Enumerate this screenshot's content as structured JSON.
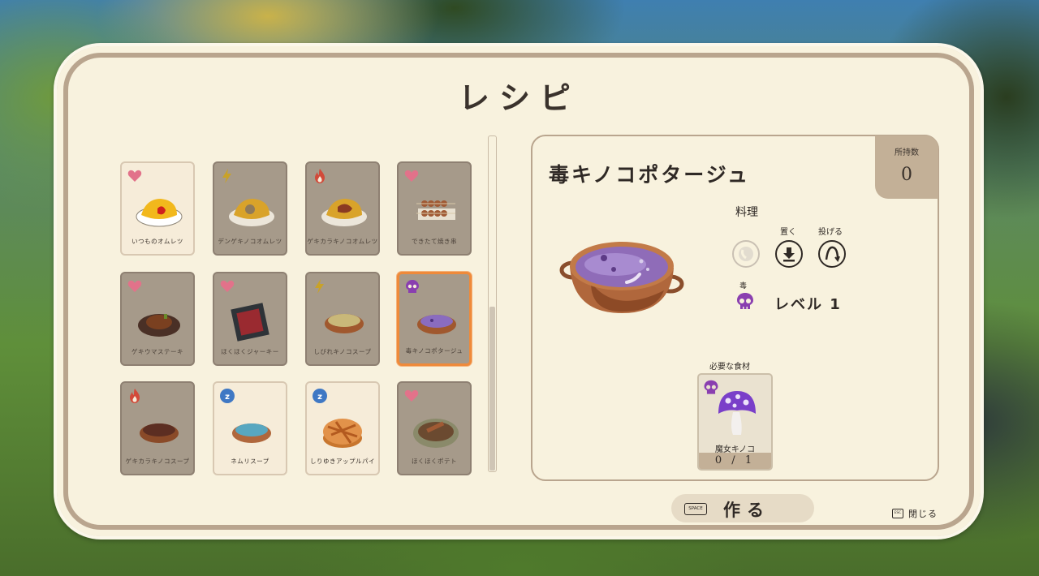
{
  "title": "レシピ",
  "recipes": [
    {
      "name": "いつものオムレツ",
      "category": "heart-icon",
      "dish": "omelet-plain",
      "state": "owned"
    },
    {
      "name": "デンゲキノコオムレツ",
      "category": "lightning-icon",
      "dish": "omelet-mushroom",
      "state": "dim"
    },
    {
      "name": "ゲキカラキノコオムレツ",
      "category": "fire-icon",
      "dish": "omelet-spicy",
      "state": "dim"
    },
    {
      "name": "できたて焼き串",
      "category": "heart-icon",
      "dish": "skewers",
      "state": "dim"
    },
    {
      "name": "ゲキウマステーキ",
      "category": "heart-icon",
      "dish": "steak",
      "state": "dim"
    },
    {
      "name": "ほくほくジャーキー",
      "category": "heart-icon",
      "dish": "jerky",
      "state": "dim"
    },
    {
      "name": "しびれキノコスープ",
      "category": "lightning-icon",
      "dish": "soup-yellow",
      "state": "dim"
    },
    {
      "name": "毒キノコポタージュ",
      "category": "skull-icon",
      "dish": "soup-purple",
      "state": "selected"
    },
    {
      "name": "ゲキカラキノコスープ",
      "category": "fire-icon",
      "dish": "soup-red",
      "state": "dim"
    },
    {
      "name": "ネムリスープ",
      "category": "sleep-icon",
      "dish": "soup-blue",
      "state": "owned"
    },
    {
      "name": "しりゆきアップルパイ",
      "category": "sleep-icon",
      "dish": "apple-pie",
      "state": "owned"
    },
    {
      "name": "ほくほくポテト",
      "category": "heart-icon",
      "dish": "potato",
      "state": "dim"
    }
  ],
  "detail": {
    "name": "毒キノコポタージュ",
    "owned_label": "所持数",
    "owned_count": "0",
    "type_label": "料理",
    "actions": [
      {
        "label": "",
        "icon": "eat-icon",
        "enabled": false
      },
      {
        "label": "置く",
        "icon": "place-icon",
        "enabled": true
      },
      {
        "label": "投げる",
        "icon": "throw-icon",
        "enabled": true
      }
    ],
    "effect_label": "毒",
    "effect_icon": "skull-icon",
    "level_text": "レベル 1",
    "ingredients_label": "必要な食材",
    "ingredient": {
      "name": "魔女キノコ",
      "count": "0 / 1",
      "icon": "witch-mushroom-icon"
    }
  },
  "make_button": {
    "key": "SPACE",
    "label": "作る"
  },
  "close_button": {
    "key": "ESC",
    "label": "閉じる"
  },
  "colors": {
    "panel_bg": "#f8f2de",
    "panel_border": "#b9a58e",
    "selected_border": "#ef8a3a",
    "heart": "#e2728a",
    "lightning": "#c9a227",
    "fire": "#d24a3a",
    "sleep": "#3f78c4",
    "poison": "#8a3fb0"
  }
}
